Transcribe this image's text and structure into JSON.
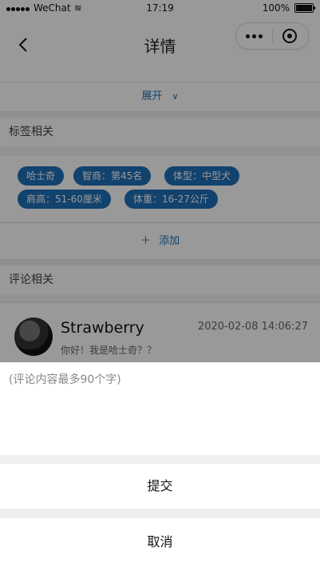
{
  "status": {
    "carrier": "WeChat",
    "time": "17:19",
    "battery": "100%"
  },
  "nav": {
    "title": "详情"
  },
  "expand": {
    "label": "展开"
  },
  "tags_section": {
    "title": "标签相关",
    "tags": [
      "哈士奇",
      "智商：第45名",
      "体型：中型犬",
      "肩高：51-60厘米",
      "体重：16-27公斤"
    ],
    "add_label": "添加"
  },
  "comments_section": {
    "title": "评论相关",
    "comments": [
      {
        "name": "Strawberry",
        "date": "2020-02-08 14:06:27",
        "text": "你好！我是哈士奇？？"
      }
    ]
  },
  "comment_sheet": {
    "placeholder": "(评论内容最多90个字)",
    "submit_label": "提交",
    "cancel_label": "取消"
  },
  "colors": {
    "accent": "#1e6fb8",
    "overlay": "rgba(0,0,0,0.4)"
  }
}
